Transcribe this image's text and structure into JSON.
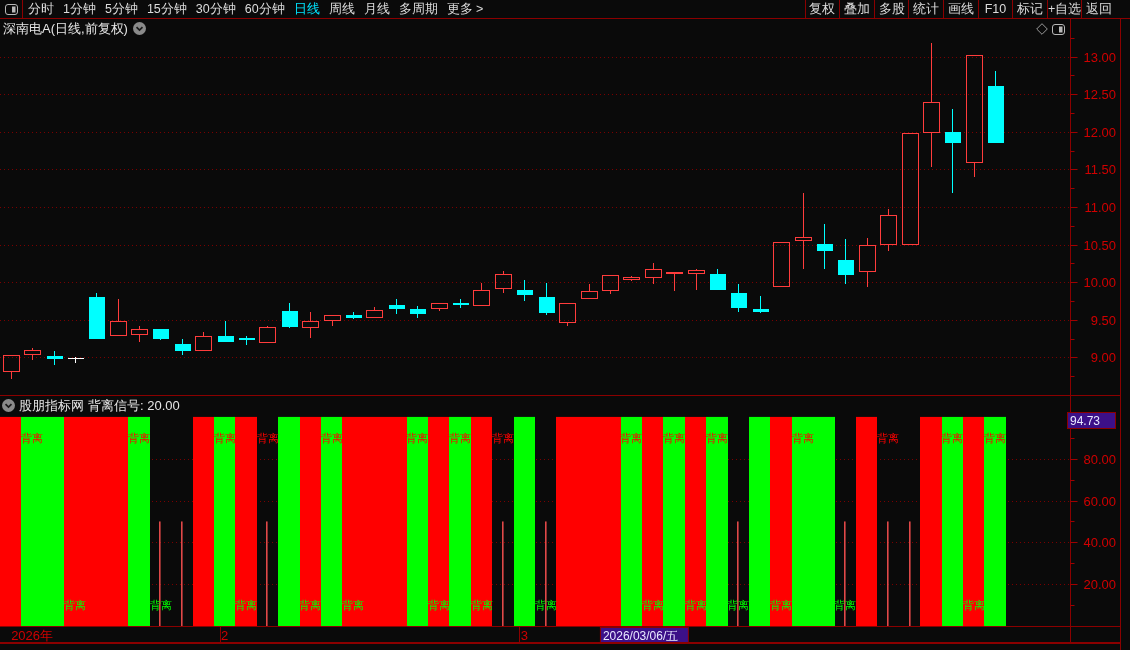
{
  "toolbar": {
    "periods": [
      {
        "label": "分时",
        "selected": false
      },
      {
        "label": "1分钟",
        "selected": false
      },
      {
        "label": "5分钟",
        "selected": false
      },
      {
        "label": "15分钟",
        "selected": false
      },
      {
        "label": "30分钟",
        "selected": false
      },
      {
        "label": "60分钟",
        "selected": false
      },
      {
        "label": "日线",
        "selected": true
      },
      {
        "label": "周线",
        "selected": false
      },
      {
        "label": "月线",
        "selected": false
      },
      {
        "label": "多周期",
        "selected": false
      },
      {
        "label": "更多 >",
        "selected": false
      }
    ],
    "buttons": [
      "复权",
      "叠加",
      "多股",
      "统计",
      "画线",
      "F10",
      "标记",
      "+自选",
      "返回"
    ]
  },
  "main_chart": {
    "title": "深南电A(日线,前复权)",
    "chart_data": {
      "type": "candlestick",
      "ylim": [
        8.5,
        13.5
      ],
      "grid": true,
      "yticks": [
        {
          "value": 9,
          "label": "9.00"
        },
        {
          "value": 9.5,
          "label": "9.50"
        },
        {
          "value": 10,
          "label": "10.00"
        },
        {
          "value": 10.5,
          "label": "10.50"
        },
        {
          "value": 11,
          "label": "11.00"
        },
        {
          "value": 11.5,
          "label": "11.50"
        },
        {
          "value": 12,
          "label": "12.00"
        },
        {
          "value": 12.5,
          "label": "12.50"
        },
        {
          "value": 13,
          "label": "13.00"
        }
      ],
      "ohlc": [
        [
          8.8,
          9.03,
          8.71,
          9.03
        ],
        [
          9.03,
          9.12,
          8.97,
          9.1
        ],
        [
          9.02,
          9.08,
          8.9,
          8.98
        ],
        [
          8.99,
          9.01,
          8.93,
          8.99
        ],
        [
          9.8,
          9.86,
          9.25,
          9.25
        ],
        [
          9.28,
          9.77,
          9.28,
          9.49
        ],
        [
          9.3,
          9.42,
          9.2,
          9.38
        ],
        [
          9.38,
          9.38,
          9.23,
          9.25
        ],
        [
          9.18,
          9.24,
          9.03,
          9.08
        ],
        [
          9.08,
          9.34,
          9.08,
          9.28
        ],
        [
          9.29,
          9.49,
          9.2,
          9.2
        ],
        [
          9.26,
          9.29,
          9.16,
          9.25
        ],
        [
          9.19,
          9.42,
          9.19,
          9.4
        ],
        [
          9.62,
          9.73,
          9.39,
          9.4
        ],
        [
          9.39,
          9.6,
          9.26,
          9.49
        ],
        [
          9.49,
          9.57,
          9.42,
          9.57
        ],
        [
          9.57,
          9.61,
          9.51,
          9.53
        ],
        [
          9.53,
          9.67,
          9.53,
          9.63
        ],
        [
          9.7,
          9.78,
          9.58,
          9.64
        ],
        [
          9.65,
          9.69,
          9.53,
          9.58
        ],
        [
          9.64,
          9.72,
          9.62,
          9.72
        ],
        [
          9.73,
          9.77,
          9.66,
          9.71
        ],
        [
          9.69,
          9.99,
          9.69,
          9.9
        ],
        [
          9.91,
          10.15,
          9.86,
          10.11
        ],
        [
          9.9,
          10.03,
          9.75,
          9.83
        ],
        [
          9.8,
          9.99,
          9.57,
          9.59
        ],
        [
          9.46,
          9.72,
          9.42,
          9.72
        ],
        [
          9.78,
          9.97,
          9.77,
          9.88
        ],
        [
          9.88,
          10.1,
          9.84,
          10.1
        ],
        [
          10.03,
          10.08,
          10.02,
          10.07
        ],
        [
          10.05,
          10.25,
          9.98,
          10.17
        ],
        [
          10.12,
          10.14,
          9.88,
          10.14
        ],
        [
          10.11,
          10.17,
          9.89,
          10.16
        ],
        [
          10.11,
          10.17,
          9.9,
          9.9
        ],
        [
          9.86,
          9.97,
          9.61,
          9.66
        ],
        [
          9.65,
          9.82,
          9.59,
          9.6
        ],
        [
          9.94,
          10.54,
          9.93,
          10.54
        ],
        [
          10.55,
          11.19,
          10.18,
          10.6
        ],
        [
          10.51,
          10.78,
          10.18,
          10.42
        ],
        [
          10.29,
          10.58,
          9.97,
          10.1
        ],
        [
          10.14,
          10.59,
          9.93,
          10.5
        ],
        [
          10.5,
          10.98,
          10.41,
          10.9
        ],
        [
          10.5,
          11.98,
          10.5,
          11.98
        ],
        [
          11.98,
          13.18,
          11.53,
          12.4
        ],
        [
          12.0,
          12.3,
          11.19,
          11.85
        ],
        [
          11.59,
          13.02,
          11.4,
          13.02
        ],
        [
          12.61,
          12.81,
          11.85,
          11.85
        ],
        null,
        null,
        null
      ]
    }
  },
  "indicator": {
    "name": "股朋指标网",
    "reading": "背离信号: 20.00",
    "value_label": "94.73",
    "date_label": "2026/03/06/五",
    "chart_data": {
      "type": "bar",
      "ylim": [
        0,
        110
      ],
      "grid": true,
      "yticks": [
        {
          "value": 20,
          "label": "20.00"
        },
        {
          "value": 40,
          "label": "40.00"
        },
        {
          "value": 60,
          "label": "60.00"
        },
        {
          "value": 80,
          "label": "80.00"
        }
      ],
      "categories": [
        null,
        "2026年",
        null,
        null,
        null,
        null,
        null,
        null,
        null,
        null,
        "2",
        null,
        null,
        null,
        null,
        null,
        null,
        null,
        null,
        null,
        null,
        null,
        null,
        null,
        "3",
        null,
        null,
        null,
        null,
        null,
        null,
        null,
        null,
        null,
        null,
        null,
        null,
        null,
        null,
        null,
        null,
        null,
        null,
        null,
        null,
        null,
        null,
        null,
        null,
        null
      ],
      "series": [
        {
          "values": [
            100,
            100,
            100,
            100,
            100,
            100,
            100,
            null,
            null,
            100,
            100,
            100,
            null,
            100,
            100,
            100,
            100,
            100,
            100,
            100,
            100,
            100,
            100,
            null,
            100,
            null,
            100,
            100,
            100,
            100,
            100,
            100,
            100,
            100,
            null,
            100,
            100,
            100,
            100,
            null,
            100,
            null,
            null,
            100,
            100,
            100,
            100,
            null,
            null,
            null
          ],
          "colors": [
            "#ff0000",
            "#00ff00",
            "#00ff00",
            "#ff0000",
            "#ff0000",
            "#ff0000",
            "#00ff00",
            null,
            null,
            "#ff0000",
            "#00ff00",
            "#ff0000",
            null,
            "#00ff00",
            "#ff0000",
            "#00ff00",
            "#ff0000",
            "#ff0000",
            "#ff0000",
            "#00ff00",
            "#ff0000",
            "#00ff00",
            "#ff0000",
            null,
            "#00ff00",
            null,
            "#ff0000",
            "#ff0000",
            "#ff0000",
            "#00ff00",
            "#ff0000",
            "#00ff00",
            "#ff0000",
            "#00ff00",
            null,
            "#00ff00",
            "#ff0000",
            "#00ff00",
            "#00ff00",
            null,
            "#ff0000",
            null,
            null,
            "#ff0000",
            "#00ff00",
            "#ff0000",
            "#00ff00",
            null,
            null,
            null
          ]
        },
        {
          "color": "#e04848",
          "values": [
            null,
            null,
            null,
            null,
            null,
            null,
            null,
            50,
            50,
            null,
            null,
            null,
            50,
            null,
            null,
            null,
            null,
            null,
            null,
            null,
            null,
            null,
            null,
            50,
            null,
            50,
            null,
            null,
            null,
            null,
            null,
            null,
            null,
            null,
            50,
            null,
            null,
            null,
            null,
            50,
            null,
            50,
            50,
            null,
            null,
            null,
            null,
            null,
            null,
            null
          ]
        }
      ],
      "annotations": [
        "背离",
        "背离",
        "背离",
        "背离",
        "背离",
        "背离",
        "背离",
        "背离",
        "背离",
        "背离",
        "背离",
        "背离",
        "背离",
        "背离",
        "背离",
        "背离",
        "背离",
        "背离",
        "背离",
        "背离",
        "背离",
        "背离",
        "背离",
        "背离",
        "背离",
        "背离",
        "背离",
        "背离",
        "背离"
      ]
    }
  }
}
